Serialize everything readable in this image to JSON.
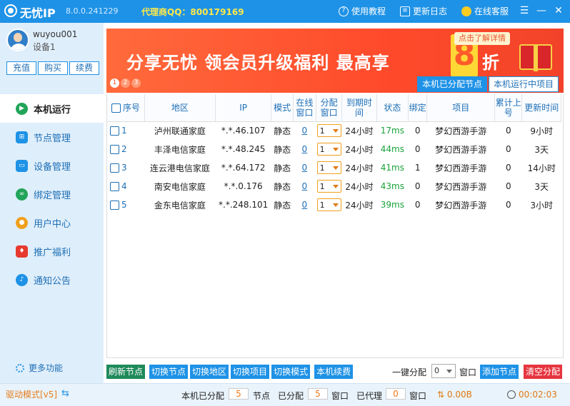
{
  "app": {
    "title": "无忧IP",
    "version": "8.0.0.241229",
    "agent_qq": "代理商QQ：800179169",
    "tutorial": "使用教程",
    "changelog": "更新日志",
    "support": "在线客服"
  },
  "user": {
    "name": "wuyou001",
    "device": "设备1"
  },
  "side_buttons": [
    "充值",
    "购买",
    "续费"
  ],
  "menu": [
    {
      "label": "本机运行",
      "icon": "play-icon",
      "active": true
    },
    {
      "label": "节点管理",
      "icon": "network-icon"
    },
    {
      "label": "设备管理",
      "icon": "device-icon"
    },
    {
      "label": "绑定管理",
      "icon": "bind-icon"
    },
    {
      "label": "用户中心",
      "icon": "user-icon"
    },
    {
      "label": "推广福利",
      "icon": "gift-icon"
    },
    {
      "label": "通知公告",
      "icon": "bell-icon"
    }
  ],
  "more": "更多功能",
  "banner": {
    "text": "分享无忧 领会员升级福利 最高享",
    "num": "8",
    "tail": "折",
    "detail": "点击了解详情",
    "pages": [
      "1",
      "2",
      "3"
    ],
    "tabs": [
      "本机已分配节点",
      "本机运行中项目"
    ]
  },
  "table": {
    "headers": [
      "序号",
      "地区",
      "IP",
      "模式",
      "在线窗口",
      "分配窗口",
      "到期时间",
      "状态",
      "绑定",
      "项目",
      "累计上号",
      "更新时间"
    ],
    "rows": [
      {
        "no": "1",
        "region": "泸州联通家庭",
        "ip": "*.*.46.107",
        "mode": "静态",
        "online": "0",
        "alloc": "1",
        "expire": "24小时",
        "status": "17ms",
        "bind": "0",
        "project": "梦幻西游手游",
        "total": "0",
        "updated": "9小时"
      },
      {
        "no": "2",
        "region": "丰泽电信家庭",
        "ip": "*.*.48.245",
        "mode": "静态",
        "online": "0",
        "alloc": "1",
        "expire": "24小时",
        "status": "44ms",
        "bind": "0",
        "project": "梦幻西游手游",
        "total": "0",
        "updated": "3天"
      },
      {
        "no": "3",
        "region": "连云港电信家庭",
        "ip": "*.*.64.172",
        "mode": "静态",
        "online": "0",
        "alloc": "1",
        "expire": "24小时",
        "status": "41ms",
        "bind": "1",
        "project": "梦幻西游手游",
        "total": "0",
        "updated": "14小时"
      },
      {
        "no": "4",
        "region": "南安电信家庭",
        "ip": "*.*.0.176",
        "mode": "静态",
        "online": "0",
        "alloc": "1",
        "expire": "24小时",
        "status": "43ms",
        "bind": "0",
        "project": "梦幻西游手游",
        "total": "0",
        "updated": "3天"
      },
      {
        "no": "5",
        "region": "金东电信家庭",
        "ip": "*.*.248.101",
        "mode": "静态",
        "online": "0",
        "alloc": "1",
        "expire": "24小时",
        "status": "39ms",
        "bind": "0",
        "project": "梦幻西游手游",
        "total": "0",
        "updated": "3小时"
      }
    ]
  },
  "actions": {
    "refresh": "刷新节点",
    "switch_node": "切换节点",
    "switch_region": "切换地区",
    "switch_project": "切换项目",
    "switch_mode": "切换模式",
    "renew": "本机续费",
    "onekey": "一键分配",
    "onekey_value": "0",
    "window": "窗口",
    "add_node": "添加节点",
    "clear": "清空分配"
  },
  "status": {
    "driver": "驱动模式[v5]",
    "allocated_label": "本机已分配",
    "allocated": "5",
    "node": "节点",
    "assigned_label": "已分配",
    "assigned": "5",
    "window": "窗口",
    "proxied_label": "已代理",
    "proxied": "0",
    "window2": "窗口",
    "speed": "0.00B",
    "time": "00:02:03"
  },
  "colors": {
    "accent": "#1e92e6",
    "banner": "#ff4b2b",
    "ok": "#1aa33a",
    "danger": "#e6353f"
  }
}
